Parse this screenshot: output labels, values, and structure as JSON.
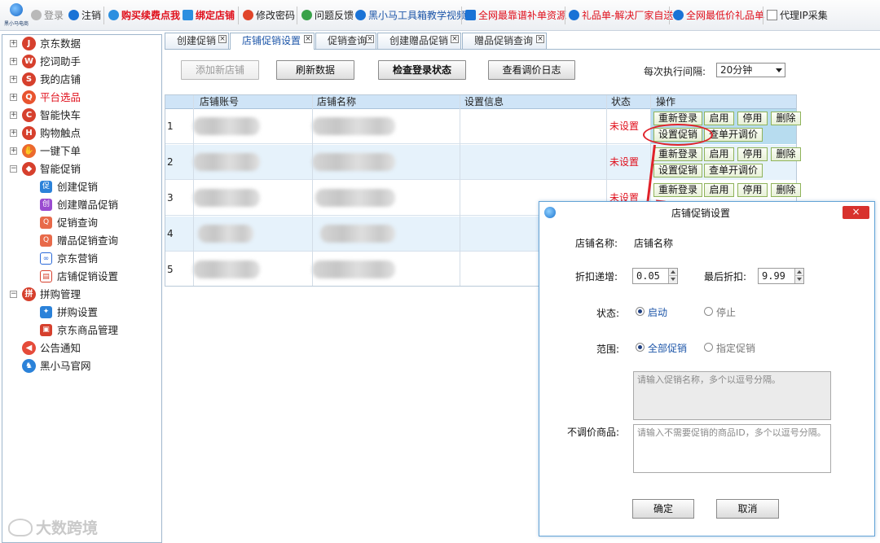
{
  "toolbar": {
    "logo_text": "黑小马电商",
    "login": "登录",
    "logout": "注销",
    "buy_renew": "购买续费点我",
    "bind_shop": "绑定店铺",
    "change_password": "修改密码",
    "feedback": "问题反馈",
    "video": "黑小马工具箱教学视频",
    "resource": "全网最靠谱补单资源",
    "gift": "礼品单-解决厂家自送",
    "cheap_gift": "全网最低价礼品单",
    "proxy_ip": "代理IP采集"
  },
  "sidebar": {
    "items": [
      {
        "label": "京东数据",
        "icon": "jd-data-icon",
        "expander": "+"
      },
      {
        "label": "挖词助手",
        "icon": "keyword-icon",
        "expander": "+"
      },
      {
        "label": "我的店铺",
        "icon": "shop-icon",
        "expander": "+"
      },
      {
        "label": "平台选品",
        "icon": "search-product-icon",
        "expander": "+"
      },
      {
        "label": "智能快车",
        "icon": "car-icon",
        "expander": "+"
      },
      {
        "label": "购物触点",
        "icon": "touchpoint-icon",
        "expander": "+"
      },
      {
        "label": "一键下单",
        "icon": "hand-icon",
        "expander": "+"
      },
      {
        "label": "智能促销",
        "icon": "tag-icon",
        "expander": "−"
      }
    ],
    "promo_children": [
      {
        "label": "创建促销",
        "icon": "create-promo-icon"
      },
      {
        "label": "创建赠品促销",
        "icon": "gift-promo-icon"
      },
      {
        "label": "促销查询",
        "icon": "promo-query-icon"
      },
      {
        "label": "赠品促销查询",
        "icon": "gift-query-icon"
      },
      {
        "label": "京东营销",
        "icon": "jd-marketing-icon"
      },
      {
        "label": "店铺促销设置",
        "icon": "shop-promo-settings-icon"
      }
    ],
    "group_buy": {
      "label": "拼购管理",
      "expander": "−"
    },
    "group_children": [
      {
        "label": "拼购设置",
        "icon": "group-settings-icon"
      },
      {
        "label": "京东商品管理",
        "icon": "jd-goods-icon"
      }
    ],
    "notice": "公告通知",
    "official": "黑小马官网"
  },
  "tabs": [
    {
      "label": "创建促销"
    },
    {
      "label": "店铺促销设置",
      "active": true
    },
    {
      "label": "促销查询"
    },
    {
      "label": "创建赠品促销"
    },
    {
      "label": "赠品促销查询"
    }
  ],
  "actions": {
    "add_shop": "添加新店铺",
    "refresh": "刷新数据",
    "check_login": "检查登录状态",
    "view_log": "查看调价日志",
    "interval_label": "每次执行间隔:",
    "interval_value": "20分钟"
  },
  "grid": {
    "headers": [
      "店铺账号",
      "店铺名称",
      "设置信息",
      "状态",
      "操作"
    ],
    "rows": [
      {
        "index": "1",
        "status": "未设置"
      },
      {
        "index": "2",
        "status": "未设置"
      },
      {
        "index": "3",
        "status": "未设置"
      },
      {
        "index": "4",
        "status": ""
      },
      {
        "index": "5",
        "status": ""
      }
    ],
    "ops": {
      "relogin": "重新登录",
      "enable": "启用",
      "disable": "停用",
      "delete": "删除",
      "set_promo": "设置促销",
      "check_price": "查单开调价"
    }
  },
  "dialog": {
    "title": "店铺促销设置",
    "close": "×",
    "shop_name_label": "店铺名称:",
    "shop_name_value": "店铺名称",
    "discount_step_label": "折扣递增:",
    "discount_step_value": "0.05",
    "final_discount_label": "最后折扣:",
    "final_discount_value": "9.99",
    "status_label": "状态:",
    "status_on": "启动",
    "status_off": "停止",
    "scope_label": "范围:",
    "scope_all": "全部促销",
    "scope_specified": "指定促销",
    "promo_names_placeholder": "请输入促销名称，多个以逗号分隔。",
    "no_adjust_label": "不调价商品:",
    "no_adjust_placeholder": "请输入不需要促销的商品ID，多个以逗号分隔。",
    "ok": "确定",
    "cancel": "取消"
  },
  "watermark": "大数跨境"
}
